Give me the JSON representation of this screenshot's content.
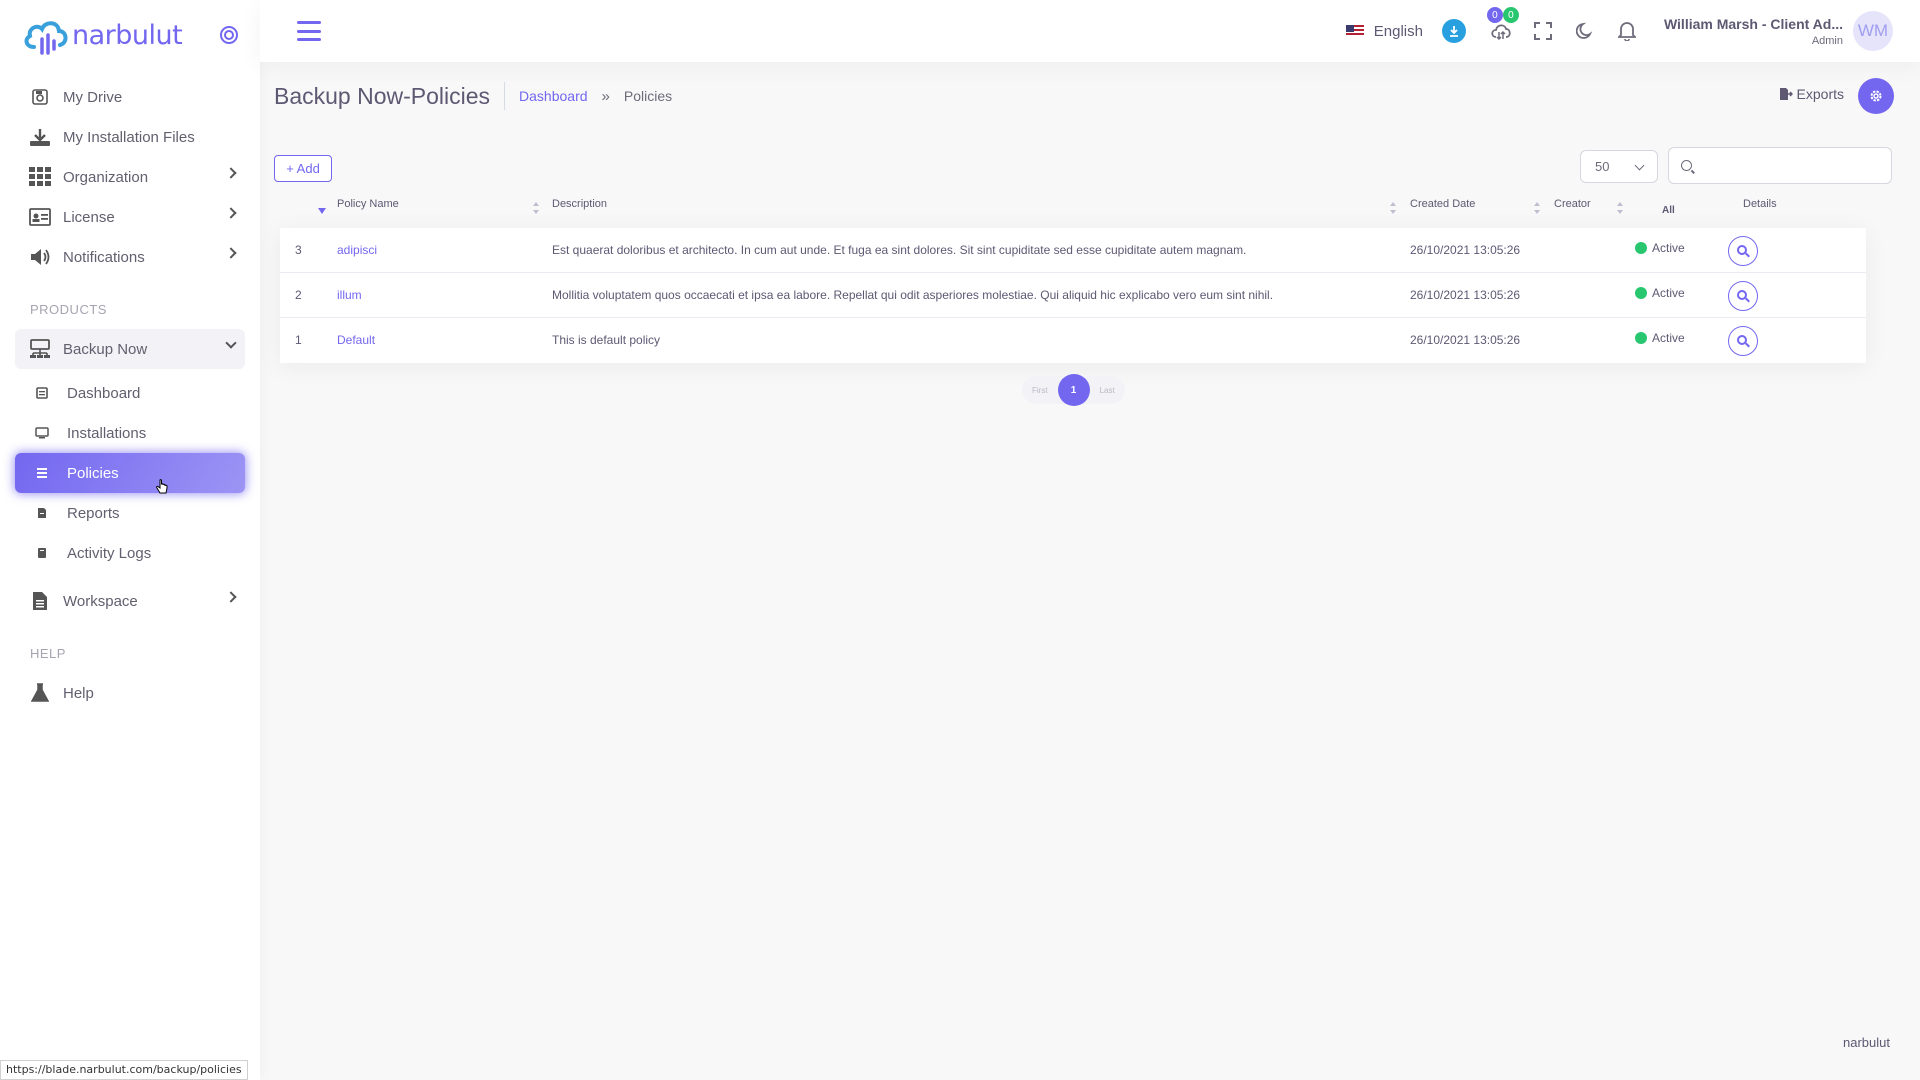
{
  "brand": {
    "name": "narbulut"
  },
  "sidebar": {
    "top_items": [
      {
        "label": "My Drive",
        "icon": "drive-icon"
      },
      {
        "label": "My Installation Files",
        "icon": "download-icon"
      },
      {
        "label": "Organization",
        "icon": "grid-icon"
      },
      {
        "label": "License",
        "icon": "license-icon"
      },
      {
        "label": "Notifications",
        "icon": "megaphone-icon"
      }
    ],
    "products_header": "PRODUCTS",
    "backup_now": "Backup Now",
    "sub_items": [
      {
        "label": "Dashboard"
      },
      {
        "label": "Installations"
      },
      {
        "label": "Policies"
      },
      {
        "label": "Reports"
      },
      {
        "label": "Activity Logs"
      }
    ],
    "workspace": "Workspace",
    "help_header": "HELP",
    "help": "Help"
  },
  "header": {
    "language": "English",
    "badge_pending": "0",
    "badge_done": "0",
    "user_name": "William Marsh - Client Ad...",
    "user_role": "Admin",
    "avatar_initials": "WM"
  },
  "page": {
    "title": "Backup Now-Policies",
    "breadcrumb": {
      "home": "Dashboard",
      "separator": "»",
      "current": "Policies"
    },
    "exports_label": "Exports",
    "add_label": "+ Add",
    "per_page": "50"
  },
  "table": {
    "columns": {
      "policy_name": "Policy Name",
      "description": "Description",
      "created_date": "Created Date",
      "creator": "Creator",
      "status_filter": "All",
      "details": "Details"
    },
    "rows": [
      {
        "id": "3",
        "name": "adipisci",
        "description": "Est quaerat doloribus et architecto. In cum aut unde. Et fuga ea sint dolores. Sit sint cupiditate sed esse cupiditate autem magnam.",
        "created": "26/10/2021 13:05:26",
        "status": "Active"
      },
      {
        "id": "2",
        "name": "illum",
        "description": "Mollitia voluptatem quos occaecati et ipsa ea labore. Repellat qui odit asperiores molestiae. Qui aliquid hic explicabo vero eum sint nihil.",
        "created": "26/10/2021 13:05:26",
        "status": "Active"
      },
      {
        "id": "1",
        "name": "Default",
        "description": "This is default policy",
        "created": "26/10/2021 13:05:26",
        "status": "Active"
      }
    ]
  },
  "pagination": {
    "first": "First",
    "current": "1",
    "last": "Last"
  },
  "footer": {
    "brand": "narbulut"
  },
  "status_bar": {
    "url": "https://blade.narbulut.com/backup/policies"
  },
  "colors": {
    "primary": "#7367f0",
    "success": "#28c76f"
  }
}
